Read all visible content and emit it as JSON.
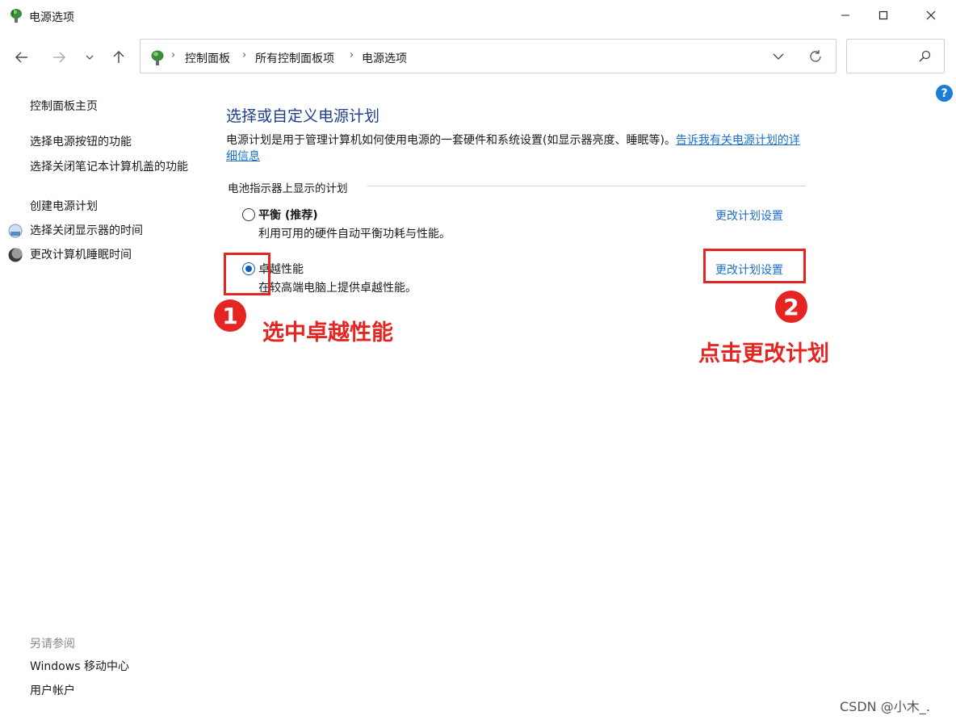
{
  "window": {
    "title": "电源选项"
  },
  "breadcrumb": {
    "items": [
      "控制面板",
      "所有控制面板项",
      "电源选项"
    ]
  },
  "sidebar": {
    "items": [
      {
        "label": "控制面板主页"
      },
      {
        "label": "选择电源按钮的功能"
      },
      {
        "label": "选择关闭笔记本计算机盖的功能"
      },
      {
        "label": "创建电源计划"
      },
      {
        "label": "选择关闭显示器的时间"
      },
      {
        "label": "更改计算机睡眠时间"
      }
    ],
    "see_also": {
      "title": "另请参阅",
      "links": [
        "Windows 移动中心",
        "用户帐户"
      ]
    }
  },
  "main": {
    "title": "选择或自定义电源计划",
    "description": "电源计划是用于管理计算机如何使用电源的一套硬件和系统设置(如显示器亮度、睡眠等)。",
    "description_link": "告诉我有关电源计划的详细信息",
    "group_label": "电池指示器上显示的计划",
    "plans": [
      {
        "name": "平衡 (推荐)",
        "description": "利用可用的硬件自动平衡功耗与性能。",
        "link": "更改计划设置",
        "selected": false
      },
      {
        "name": "卓越性能",
        "description": "在较高端电脑上提供卓越性能。",
        "link": "更改计划设置",
        "selected": true
      }
    ]
  },
  "annotations": [
    {
      "number": "1",
      "text": "选中卓越性能"
    },
    {
      "number": "2",
      "text": "点击更改计划"
    }
  ],
  "watermark": "CSDN @小木_.",
  "colors": {
    "title_blue": "#1e3f8a",
    "link_blue": "#1a6fc9",
    "annotation_red": "#e52521",
    "radio_blue": "#0a5fb4"
  }
}
